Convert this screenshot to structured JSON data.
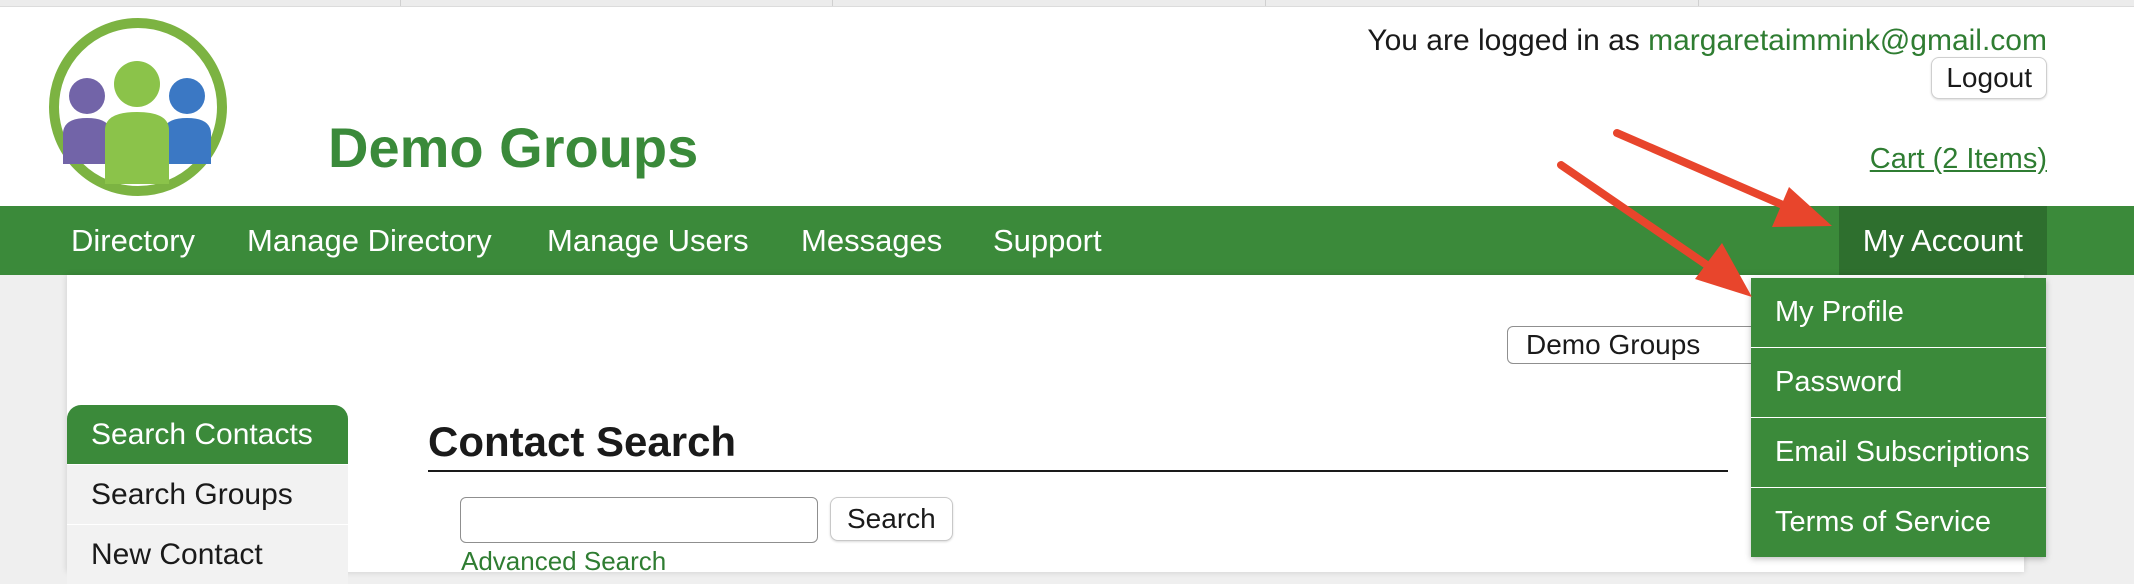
{
  "header": {
    "site_title": "Demo Groups",
    "login_prefix": "You are logged in as ",
    "login_email": "margaretaimmink@gmail.com",
    "logout_label": "Logout",
    "cart_label": "Cart (2 Items)",
    "logo_icon": "people-group-icon"
  },
  "nav": {
    "items": [
      {
        "label": "Directory"
      },
      {
        "label": "Manage Directory"
      },
      {
        "label": "Manage Users"
      },
      {
        "label": "Messages"
      },
      {
        "label": "Support"
      }
    ],
    "account_label": "My Account"
  },
  "account_menu": {
    "items": [
      {
        "label": "My Profile"
      },
      {
        "label": "Password"
      },
      {
        "label": "Email Subscriptions"
      },
      {
        "label": "Terms of Service"
      }
    ]
  },
  "group_select": {
    "selected": "Demo Groups"
  },
  "sidebar": {
    "items": [
      {
        "label": "Search Contacts"
      },
      {
        "label": "Search Groups"
      },
      {
        "label": "New Contact"
      }
    ]
  },
  "main": {
    "heading": "Contact Search",
    "search_value": "",
    "search_button": "Search",
    "advanced_link": "Advanced Search"
  },
  "colors": {
    "brand_green": "#3b8a3a",
    "nav_active": "#2e6f2e",
    "link_green": "#2f7d32",
    "annotation_arrow": "#e8452c"
  }
}
